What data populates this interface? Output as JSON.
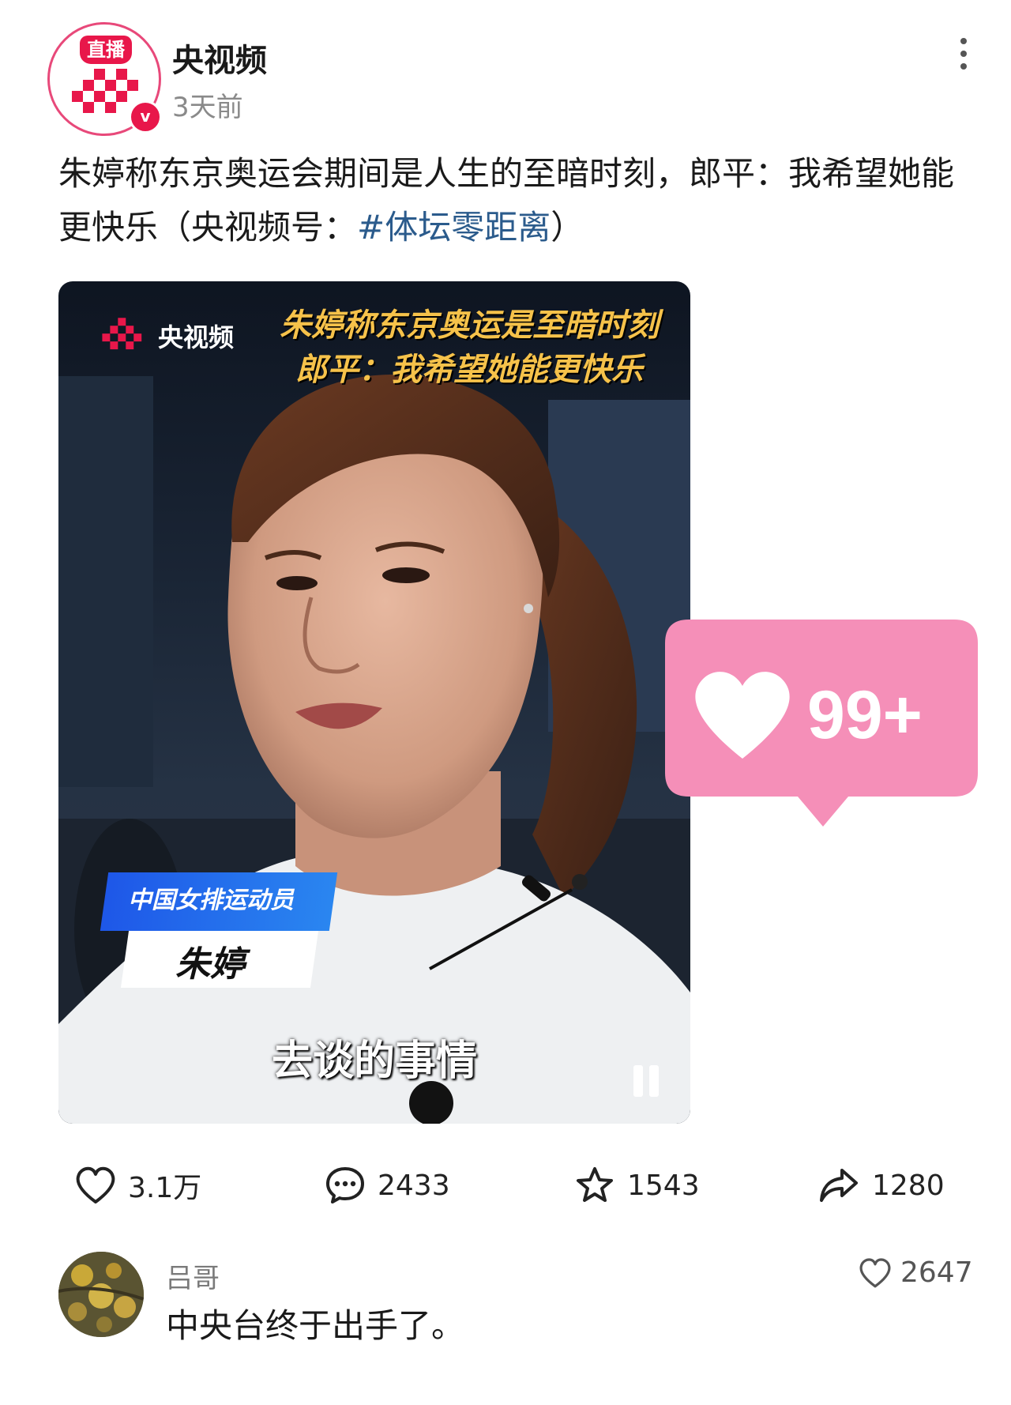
{
  "post": {
    "account_name": "央视频",
    "time": "3天前",
    "avatar_live_tag": "直播",
    "avatar_badge": "v",
    "text_main": "朱婷称东京奥运会期间是人生的至暗时刻，郎平：我希望她能更快乐（央视频号：",
    "hashtag": "#体坛零距离",
    "text_end": "）"
  },
  "video": {
    "logo_text": "央视频",
    "headline_line1": "朱婷称东京奥运是至暗时刻",
    "headline_line2": "郎平：我希望她能更快乐",
    "name_tag_role": "中国女排运动员",
    "name_tag_name": "朱婷",
    "subtitle": "去谈的事情",
    "state": "playing"
  },
  "like_bubble": {
    "label": "99+",
    "color": "#f58fb8"
  },
  "actions": {
    "likes": "3.1万",
    "comments": "2433",
    "favorites": "1543",
    "shares": "1280"
  },
  "comment": {
    "author": "吕哥",
    "text": "中央台终于出手了。",
    "likes": "2647"
  },
  "colors": {
    "brand_red": "#e8174a",
    "hashtag": "#2b5b8c",
    "headline_yellow": "#f6c24a"
  }
}
